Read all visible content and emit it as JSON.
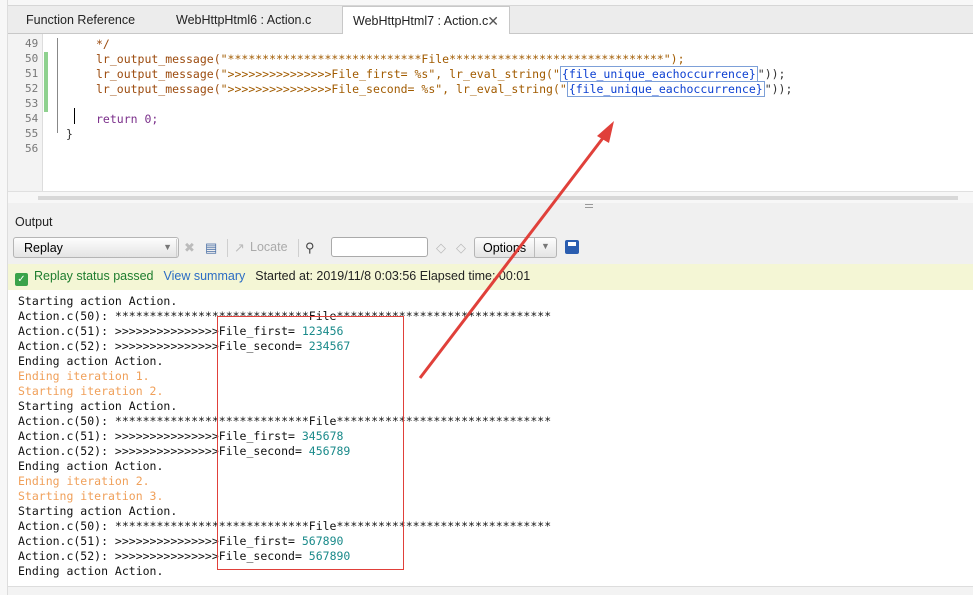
{
  "tabs": [
    {
      "label": "Function Reference",
      "active": false
    },
    {
      "label": "WebHttpHtml6 : Action.c",
      "active": false
    },
    {
      "label": "WebHttpHtml7 : Action.c",
      "active": true
    }
  ],
  "editor": {
    "line_numbers": [
      "49",
      "50",
      "51",
      "52",
      "53",
      "54",
      "55",
      "56"
    ],
    "lines": {
      "l49": "*/",
      "l50_call": "lr_output_message(",
      "l50_str": "\"****************************File*******************************\");",
      "l51_call": "lr_output_message(",
      "l51_str": "\">>>>>>>>>>>>>>>File_first= %s\", lr_eval_string(\"",
      "l51_var": "{file_unique_eachoccurrence}",
      "l51_end": "\"));",
      "l52_call": "lr_output_message(",
      "l52_str": "\">>>>>>>>>>>>>>>File_second= %s\", lr_eval_string(\"",
      "l52_var": "{file_unique_eachoccurrence}",
      "l52_end": "\"));",
      "l54": "return 0;",
      "l55": "}"
    }
  },
  "output": {
    "title": "Output",
    "mode_select": "Replay",
    "locate_label": "Locate",
    "options_label": "Options",
    "search_placeholder": ""
  },
  "status": {
    "passed": "Replay status passed",
    "view_summary": "View summary",
    "started": "Started at: 2019/11/8 0:03:56 Elapsed time: 00:01"
  },
  "log": [
    {
      "text": "Starting action Action.",
      "kind": "normal"
    },
    {
      "text": "Action.c(50): ****************************File*******************************",
      "kind": "normal"
    },
    {
      "text": "Action.c(51): >>>>>>>>>>>>>>>File_first= ",
      "value": "123456",
      "kind": "value"
    },
    {
      "text": "Action.c(52): >>>>>>>>>>>>>>>File_second= ",
      "value": "234567",
      "kind": "value"
    },
    {
      "text": "Ending action Action.",
      "kind": "normal"
    },
    {
      "text": "Ending iteration 1.",
      "kind": "iter"
    },
    {
      "text": "Starting iteration 2.",
      "kind": "iter"
    },
    {
      "text": "Starting action Action.",
      "kind": "normal"
    },
    {
      "text": "Action.c(50): ****************************File*******************************",
      "kind": "normal"
    },
    {
      "text": "Action.c(51): >>>>>>>>>>>>>>>File_first= ",
      "value": "345678",
      "kind": "value"
    },
    {
      "text": "Action.c(52): >>>>>>>>>>>>>>>File_second= ",
      "value": "456789",
      "kind": "value"
    },
    {
      "text": "Ending action Action.",
      "kind": "normal"
    },
    {
      "text": "Ending iteration 2.",
      "kind": "iter"
    },
    {
      "text": "Starting iteration 3.",
      "kind": "iter"
    },
    {
      "text": "Starting action Action.",
      "kind": "normal"
    },
    {
      "text": "Action.c(50): ****************************File*******************************",
      "kind": "normal"
    },
    {
      "text": "Action.c(51): >>>>>>>>>>>>>>>File_first= ",
      "value": "567890",
      "kind": "value"
    },
    {
      "text": "Action.c(52): >>>>>>>>>>>>>>>File_second= ",
      "value": "567890",
      "kind": "value"
    },
    {
      "text": "Ending action Action.",
      "kind": "normal"
    }
  ],
  "colors": {
    "annotation": "#e0403a",
    "iteration_text": "#f0a05a",
    "value_text": "#1a8a8a"
  }
}
